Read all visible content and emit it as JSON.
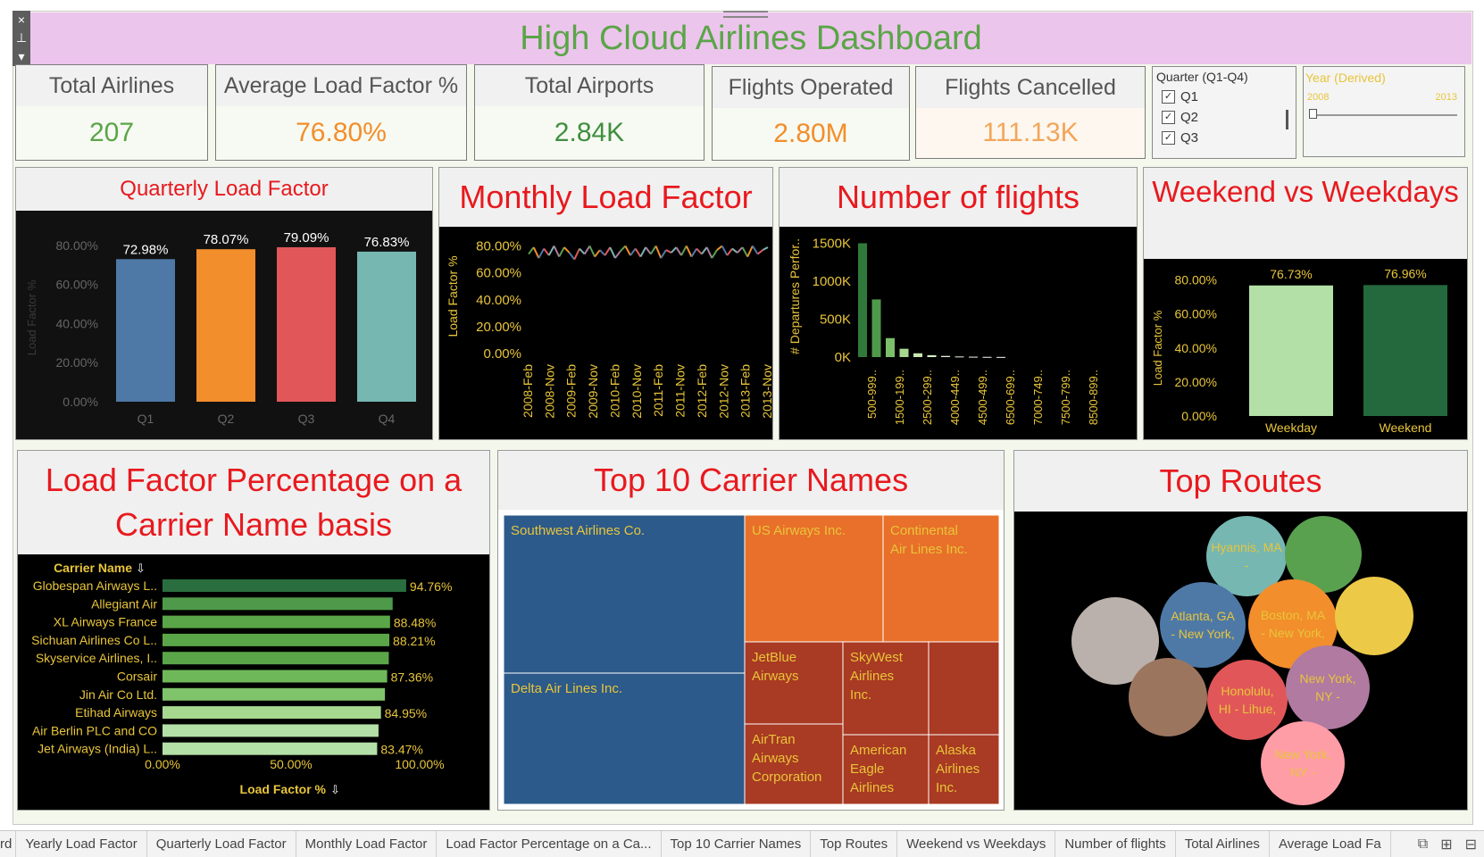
{
  "title": "High Cloud Airlines Dashboard",
  "window_controls": [
    "×",
    "⊥",
    "▾"
  ],
  "kpis": [
    {
      "label": "Total Airlines",
      "value": "207",
      "color": "#5aa548"
    },
    {
      "label": "Average Load Factor %",
      "value": "76.80%",
      "color": "#f28e2b"
    },
    {
      "label": "Total Airports",
      "value": "2.84K",
      "color": "#3f8f3f"
    },
    {
      "label": "Flights Operated",
      "value": "2.80M",
      "color": "#f28e2b"
    },
    {
      "label": "Flights Cancelled",
      "value": "111.13K",
      "color": "#f2a65a"
    }
  ],
  "quarter_filter": {
    "title": "Quarter (Q1-Q4)",
    "items": [
      "Q1",
      "Q2",
      "Q3"
    ]
  },
  "year_filter": {
    "title": "Year (Derived)",
    "min": "2008",
    "max": "2013"
  },
  "panels": {
    "quarterly": "Quarterly Load Factor",
    "monthly": "Monthly Load Factor",
    "flights": "Number of flights",
    "weekend": "Weekend vs Weekdays",
    "carrier": "Load Factor Percentage on a Carrier Name basis",
    "top10": "Top 10 Carrier Names",
    "routes": "Top Routes"
  },
  "chart_data": [
    {
      "type": "bar",
      "title": "Quarterly Load Factor",
      "ylabel": "Load Factor %",
      "categories": [
        "Q1",
        "Q2",
        "Q3",
        "Q4"
      ],
      "values": [
        72.98,
        78.07,
        79.09,
        76.83
      ],
      "value_labels": [
        "72.98%",
        "78.07%",
        "79.09%",
        "76.83%"
      ],
      "colors": [
        "#4e79a7",
        "#f28e2b",
        "#e15759",
        "#76b7b2"
      ],
      "ylim": [
        0,
        85
      ],
      "yticks": [
        "0.00%",
        "20.00%",
        "40.00%",
        "60.00%",
        "80.00%"
      ]
    },
    {
      "type": "line",
      "title": "Monthly Load Factor",
      "ylabel": "Load Factor %",
      "x_ticks": [
        "2008-Feb",
        "2008-Nov",
        "2009-Feb",
        "2009-Nov",
        "2010-Feb",
        "2010-Nov",
        "2011-Feb",
        "2011-Nov",
        "2012-Feb",
        "2012-Nov",
        "2013-Feb",
        "2013-Nov"
      ],
      "values": [
        74,
        79,
        71,
        78,
        73,
        80,
        72,
        79,
        75,
        70,
        78,
        74,
        80,
        72,
        77,
        73,
        79,
        71,
        76,
        80,
        73,
        78,
        72,
        79,
        74,
        80,
        71,
        77,
        75,
        79,
        73,
        80,
        72,
        78,
        74,
        79,
        71,
        77,
        80,
        73,
        78,
        75,
        79,
        72,
        80,
        74,
        77,
        79
      ],
      "ylim": [
        0,
        85
      ],
      "yticks": [
        "0.00%",
        "20.00%",
        "40.00%",
        "60.00%",
        "80.00%"
      ]
    },
    {
      "type": "bar",
      "title": "Number of flights",
      "ylabel": "# Departures Perfor..",
      "categories": [
        "500-999..",
        "1500-199..",
        "2500-299..",
        "4000-449..",
        "4500-499..",
        "6500-699..",
        "7000-749..",
        "7500-799..",
        "8500-899.."
      ],
      "values": [
        1500,
        760,
        250,
        110,
        50,
        25,
        15,
        8,
        5,
        3,
        2
      ],
      "colors": [
        "#2f7a3a",
        "#4e9a4a",
        "#7cbf6a",
        "#a8d88f",
        "#c6e8b0",
        "#d8f0c8",
        "#e5f5da",
        "#eef8e6",
        "#f3faee",
        "#f6fbf2",
        "#f8fcf5"
      ],
      "ylim": [
        0,
        1600
      ],
      "yticks": [
        "0K",
        "500K",
        "1000K",
        "1500K"
      ]
    },
    {
      "type": "bar",
      "title": "Weekend vs Weekdays",
      "ylabel": "Load Factor %",
      "categories": [
        "Weekday",
        "Weekend"
      ],
      "values": [
        76.73,
        76.96
      ],
      "value_labels": [
        "76.73%",
        "76.96%"
      ],
      "colors": [
        "#b3e0a6",
        "#24693d"
      ],
      "ylim": [
        0,
        85
      ],
      "yticks": [
        "0.00%",
        "20.00%",
        "40.00%",
        "60.00%",
        "80.00%"
      ]
    },
    {
      "type": "bar",
      "title": "Load Factor Percentage on a Carrier Name basis",
      "xlabel": "Load Factor %",
      "ylabel": "Carrier Name",
      "categories": [
        "Globespan Airways L..",
        "Allegiant Air",
        "XL Airways France",
        "Sichuan Airlines Co L..",
        "Skyservice Airlines, I..",
        "Corsair",
        "Jin Air Co Ltd.",
        "Etihad Airways",
        "Air Berlin PLC and CO",
        "Jet Airways (India) L.."
      ],
      "values": [
        94.76,
        89.5,
        88.48,
        88.21,
        88.0,
        87.36,
        86.5,
        84.95,
        84.0,
        83.47
      ],
      "value_labels": [
        "94.76%",
        "",
        "88.48%",
        "88.21%",
        "",
        "87.36%",
        "",
        "84.95%",
        "",
        "83.47%"
      ],
      "colors": [
        "#2a6e3f",
        "#4e9a4a",
        "#5aa548",
        "#5aa548",
        "#5aa548",
        "#6fb85a",
        "#7fc46a",
        "#a6d98f",
        "#b3e0a6",
        "#b3e0a6"
      ],
      "xlim": [
        0,
        100
      ],
      "xticks": [
        "0.00%",
        "50.00%",
        "100.00%"
      ]
    },
    {
      "type": "treemap",
      "title": "Top 10 Carrier Names",
      "items": [
        {
          "name": "Southwest Airlines Co.",
          "color": "#2c5a8a"
        },
        {
          "name": "Delta Air Lines Inc.",
          "color": "#2c5a8a"
        },
        {
          "name": "US Airways Inc.",
          "color": "#e8702a"
        },
        {
          "name": "Continental Air Lines Inc.",
          "color": "#e8702a"
        },
        {
          "name": "JetBlue Airways",
          "color": "#a93a23"
        },
        {
          "name": "SkyWest Airlines Inc.",
          "color": "#a93a23"
        },
        {
          "name": "",
          "color": "#a93a23"
        },
        {
          "name": "AirTran Airways Corporation",
          "color": "#a93a23"
        },
        {
          "name": "American Eagle Airlines",
          "color": "#a93a23"
        },
        {
          "name": "Alaska Airlines Inc.",
          "color": "#a93a23"
        }
      ]
    },
    {
      "type": "bubble",
      "title": "Top Routes",
      "items": [
        {
          "label": "Hyannis, MA -",
          "color": "#76b7b2"
        },
        {
          "label": "",
          "color": "#59a14f"
        },
        {
          "label": "Atlanta, GA - New York,",
          "color": "#4e79a7"
        },
        {
          "label": "Boston, MA - New York,",
          "color": "#f28e2b"
        },
        {
          "label": "",
          "color": "#edc948"
        },
        {
          "label": "",
          "color": "#bab0ac"
        },
        {
          "label": "",
          "color": "#9c755f"
        },
        {
          "label": "Honolulu, HI - Lihue,",
          "color": "#e15759"
        },
        {
          "label": "New York, NY -",
          "color": "#b07aa1"
        },
        {
          "label": "New York, NY -",
          "color": "#ff9da7"
        }
      ]
    }
  ],
  "tabs": [
    "rd",
    "Yearly Load Factor",
    "Quarterly Load Factor",
    "Monthly Load Factor",
    "Load Factor Percentage on a Ca...",
    "Top 10 Carrier Names",
    "Top Routes",
    "Weekend vs Weekdays",
    "Number of flights",
    "Total Airlines",
    "Average Load Fa"
  ],
  "tab_icons": [
    "⧉",
    "⊞",
    "⊟"
  ],
  "sort_icon": "⇩"
}
